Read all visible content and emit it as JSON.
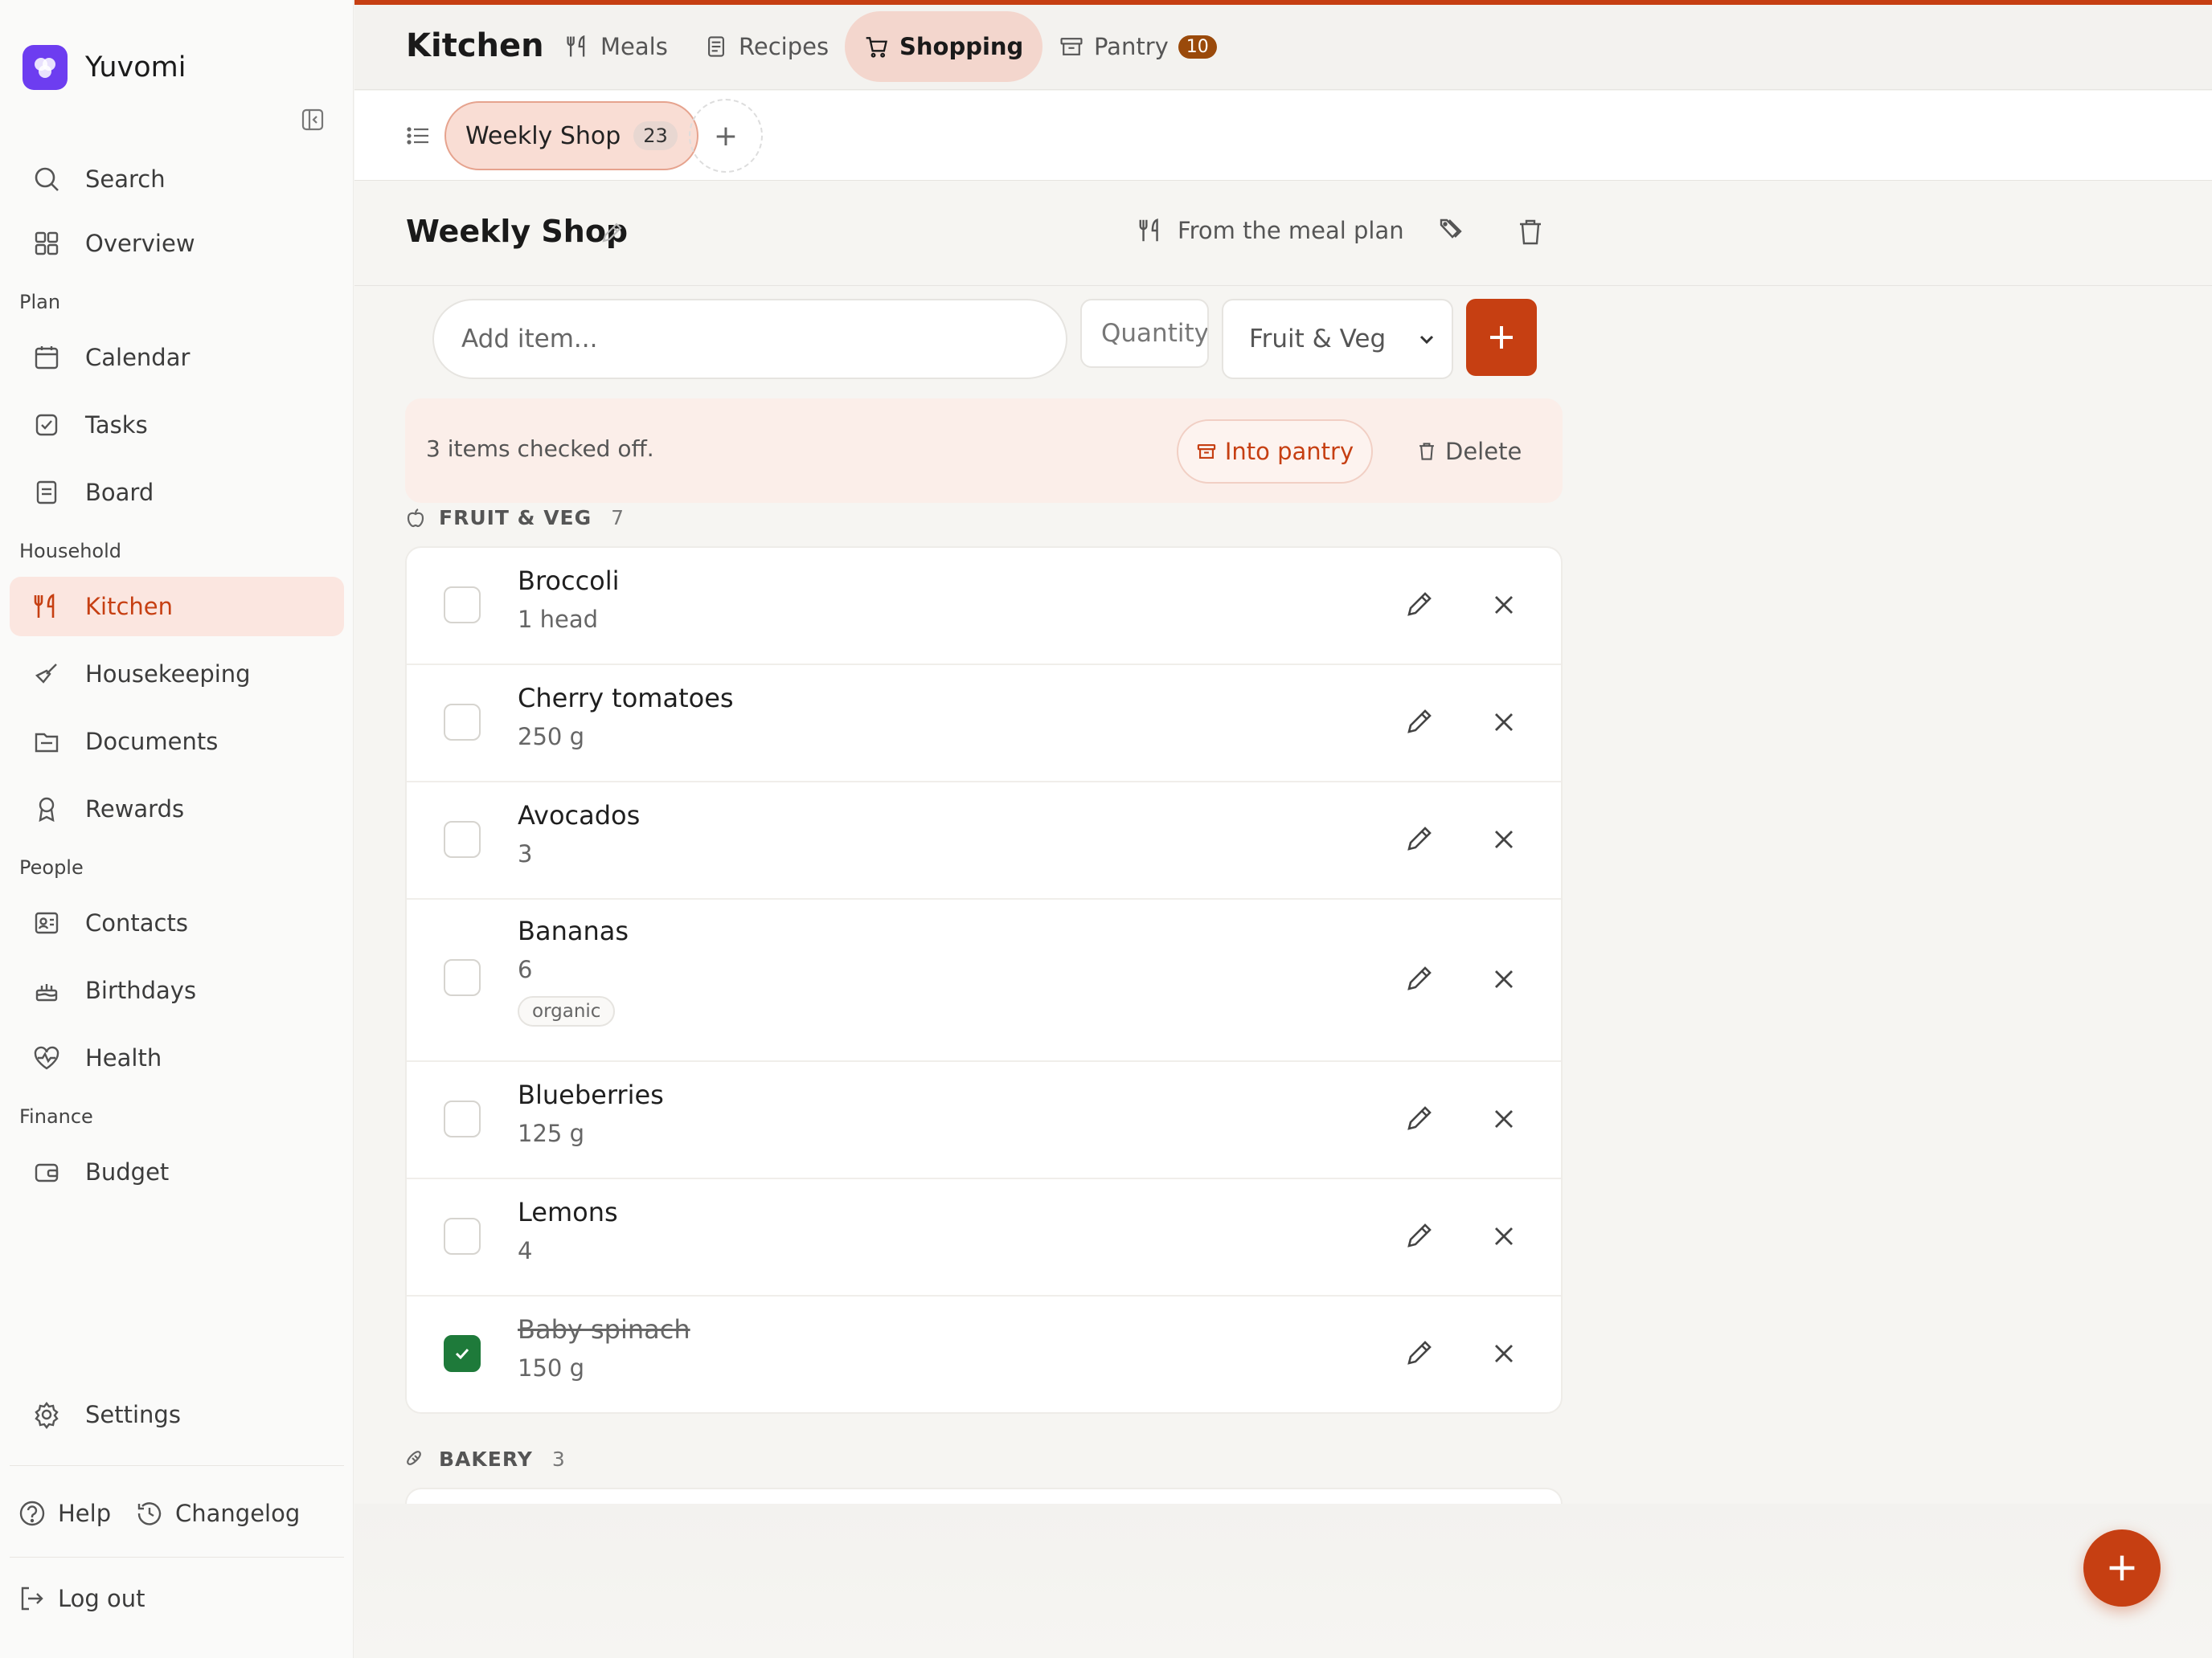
{
  "brand": {
    "name": "Yuvomi"
  },
  "sidebar": {
    "top_items": [
      {
        "label": "Search",
        "icon": "search-icon"
      },
      {
        "label": "Overview",
        "icon": "grid-icon"
      }
    ],
    "sections": [
      {
        "title": "Plan",
        "items": [
          {
            "label": "Calendar",
            "icon": "calendar-icon"
          },
          {
            "label": "Tasks",
            "icon": "checkbox-icon"
          },
          {
            "label": "Board",
            "icon": "board-icon"
          }
        ]
      },
      {
        "title": "Household",
        "items": [
          {
            "label": "Kitchen",
            "icon": "utensils-icon",
            "active": true
          },
          {
            "label": "Housekeeping",
            "icon": "broom-icon"
          },
          {
            "label": "Documents",
            "icon": "folder-icon"
          },
          {
            "label": "Rewards",
            "icon": "award-icon"
          }
        ]
      },
      {
        "title": "People",
        "items": [
          {
            "label": "Contacts",
            "icon": "contact-card-icon"
          },
          {
            "label": "Birthdays",
            "icon": "cake-icon"
          },
          {
            "label": "Health",
            "icon": "heart-pulse-icon"
          }
        ]
      },
      {
        "title": "Finance",
        "items": [
          {
            "label": "Budget",
            "icon": "wallet-icon"
          }
        ]
      }
    ],
    "settings": "Settings",
    "help": "Help",
    "changelog": "Changelog",
    "logout": "Log out"
  },
  "topbar": {
    "title": "Kitchen",
    "tabs": [
      {
        "label": "Meals",
        "icon": "utensils-icon"
      },
      {
        "label": "Recipes",
        "icon": "document-icon"
      },
      {
        "label": "Shopping",
        "icon": "cart-icon",
        "active": true
      },
      {
        "label": "Pantry",
        "icon": "archive-icon",
        "badge": "10"
      }
    ]
  },
  "lists": {
    "current": {
      "name": "Weekly Shop",
      "count": "23"
    },
    "add": "+"
  },
  "list_header": {
    "title": "Weekly Shop",
    "meal_plan": "From the meal plan"
  },
  "add_form": {
    "item_placeholder": "Add item...",
    "qty_placeholder": "Quantity",
    "category": "Fruit & Veg"
  },
  "notice": {
    "text": "3 items checked off.",
    "into_pantry": "Into pantry",
    "delete": "Delete"
  },
  "categories": [
    {
      "name": "FRUIT & VEG",
      "count": "7",
      "items": [
        {
          "name": "Broccoli",
          "qty": "1 head",
          "checked": false
        },
        {
          "name": "Cherry tomatoes",
          "qty": "250 g",
          "checked": false
        },
        {
          "name": "Avocados",
          "qty": "3",
          "checked": false
        },
        {
          "name": "Bananas",
          "qty": "6",
          "tag": "organic",
          "checked": false
        },
        {
          "name": "Blueberries",
          "qty": "125 g",
          "checked": false
        },
        {
          "name": "Lemons",
          "qty": "4",
          "checked": false
        },
        {
          "name": "Baby spinach",
          "qty": "150 g",
          "checked": true
        }
      ]
    },
    {
      "name": "BAKERY",
      "count": "3"
    }
  ],
  "colors": {
    "accent": "#c63f12",
    "brand": "#6d3df0",
    "checked": "#1e7a3a"
  }
}
